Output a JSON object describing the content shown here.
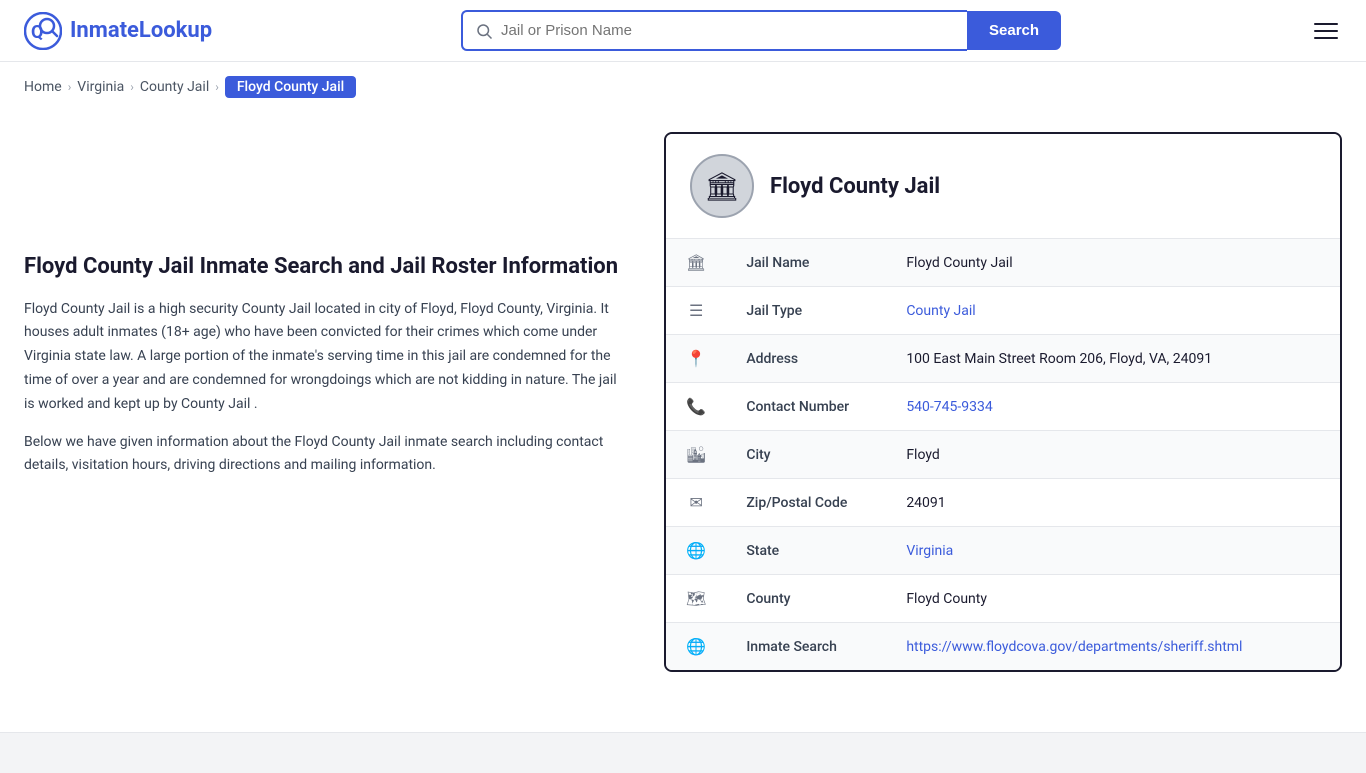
{
  "site": {
    "logo_text_part1": "Inmate",
    "logo_text_part2": "Lookup"
  },
  "header": {
    "search_placeholder": "Jail or Prison Name",
    "search_button_label": "Search",
    "hamburger_label": "Menu"
  },
  "breadcrumb": {
    "items": [
      {
        "label": "Home",
        "href": "#"
      },
      {
        "label": "Virginia",
        "href": "#"
      },
      {
        "label": "County Jail",
        "href": "#"
      },
      {
        "label": "Floyd County Jail",
        "active": true
      }
    ]
  },
  "main": {
    "page_title": "Floyd County Jail Inmate Search and Jail Roster Information",
    "description1": "Floyd County Jail is a high security County Jail located in city of Floyd, Floyd County, Virginia. It houses adult inmates (18+ age) who have been convicted for their crimes which come under Virginia state law. A large portion of the inmate's serving time in this jail are condemned for the time of over a year and are condemned for wrongdoings which are not kidding in nature. The jail is worked and kept up by County Jail .",
    "description2": "Below we have given information about the Floyd County Jail inmate search including contact details, visitation hours, driving directions and mailing information."
  },
  "card": {
    "title": "Floyd County Jail",
    "avatar_icon": "🏛",
    "rows": [
      {
        "icon": "🏛",
        "icon_name": "jail-icon",
        "label": "Jail Name",
        "value": "Floyd County Jail",
        "type": "text"
      },
      {
        "icon": "☰",
        "icon_name": "list-icon",
        "label": "Jail Type",
        "value": "County Jail",
        "type": "link",
        "href": "#"
      },
      {
        "icon": "📍",
        "icon_name": "location-icon",
        "label": "Address",
        "value": "100 East Main Street Room 206, Floyd, VA, 24091",
        "type": "text"
      },
      {
        "icon": "📞",
        "icon_name": "phone-icon",
        "label": "Contact Number",
        "value": "540-745-9334",
        "type": "link",
        "href": "tel:5407459334"
      },
      {
        "icon": "🏙",
        "icon_name": "city-icon",
        "label": "City",
        "value": "Floyd",
        "type": "text"
      },
      {
        "icon": "✉",
        "icon_name": "zip-icon",
        "label": "Zip/Postal Code",
        "value": "24091",
        "type": "text"
      },
      {
        "icon": "🌐",
        "icon_name": "state-icon",
        "label": "State",
        "value": "Virginia",
        "type": "link",
        "href": "#"
      },
      {
        "icon": "🗺",
        "icon_name": "county-icon",
        "label": "County",
        "value": "Floyd County",
        "type": "text"
      },
      {
        "icon": "🌐",
        "icon_name": "inmate-search-icon",
        "label": "Inmate Search",
        "value": "https://www.floydcova.gov/departments/sheriff.shtml",
        "type": "link",
        "href": "https://www.floydcova.gov/departments/sheriff.shtml"
      }
    ]
  }
}
